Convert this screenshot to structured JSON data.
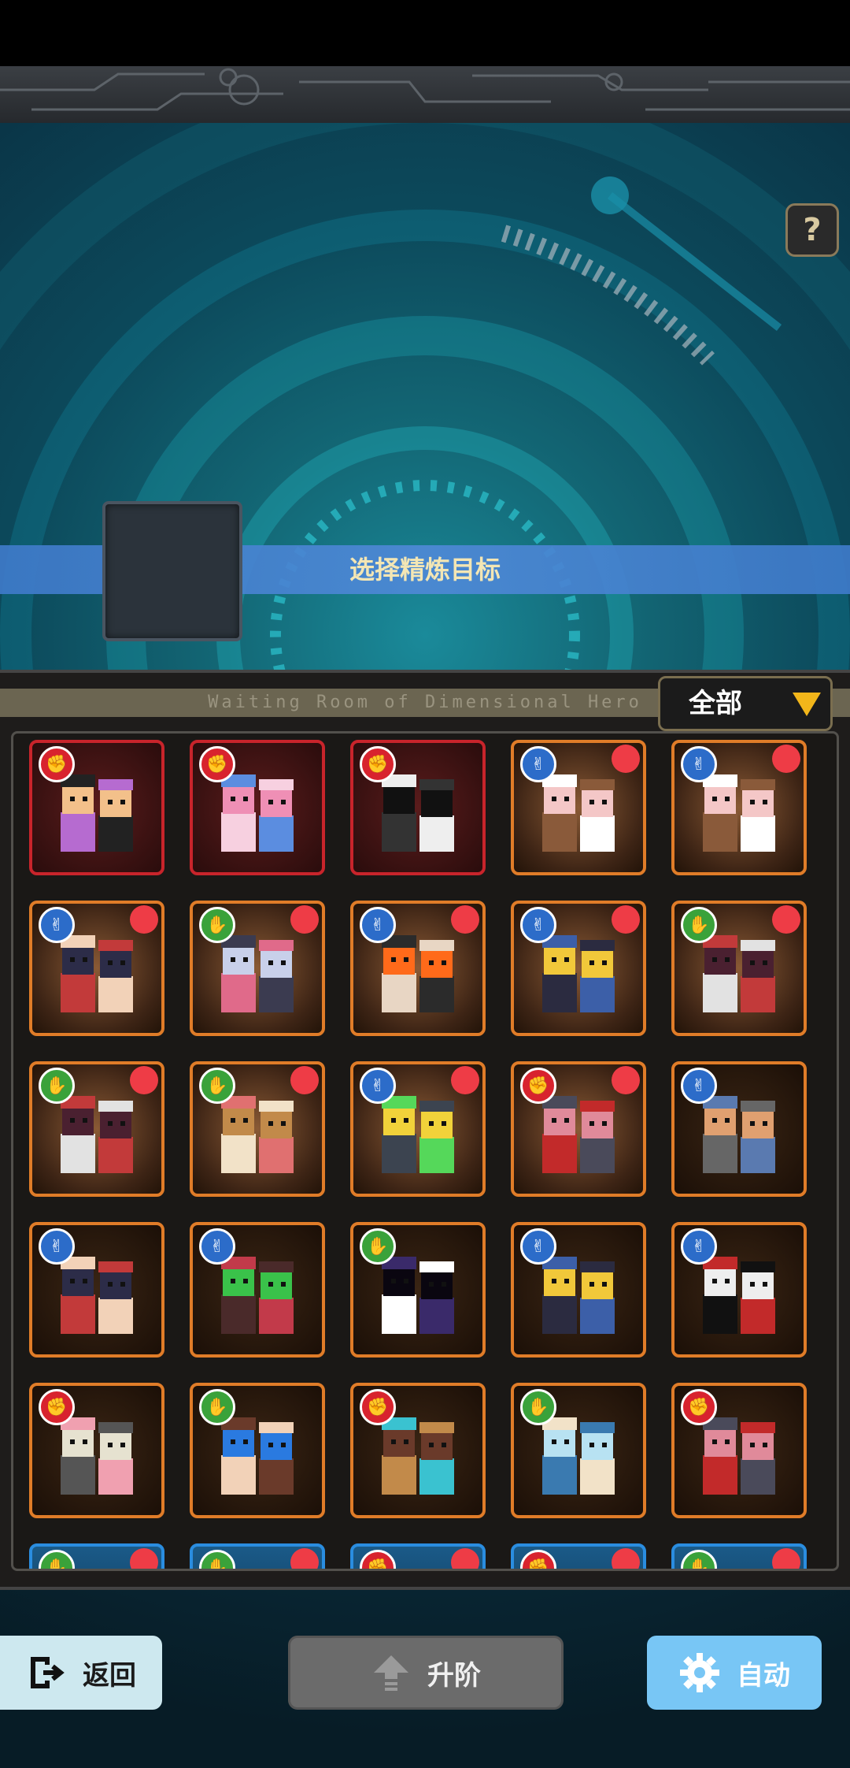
{
  "header": {
    "help_label": "?"
  },
  "banner": {
    "title": "选择精炼目标"
  },
  "strip": {
    "text": "Waiting Room of Dimensional Hero"
  },
  "filter": {
    "label": "全部"
  },
  "cards": [
    {
      "border": "red",
      "hand": "rock",
      "dot": false,
      "portrait": "crayon-boy"
    },
    {
      "border": "red",
      "hand": "rock",
      "dot": false,
      "portrait": "pink-ghost"
    },
    {
      "border": "red",
      "hand": "rock",
      "dot": false,
      "portrait": "shadow-mask"
    },
    {
      "border": "orange",
      "hand": "scissors",
      "dot": true,
      "portrait": "twins-panda"
    },
    {
      "border": "orange",
      "hand": "scissors",
      "dot": true,
      "portrait": "twins-panda"
    },
    {
      "border": "orange",
      "hand": "scissors",
      "dot": true,
      "portrait": "princess-pair"
    },
    {
      "border": "orange",
      "hand": "paper",
      "dot": true,
      "portrait": "silver-hair-ninja"
    },
    {
      "border": "orange",
      "hand": "scissors",
      "dot": true,
      "portrait": "orange-hair-kid"
    },
    {
      "border": "orange",
      "hand": "scissors",
      "dot": true,
      "portrait": "blonde-mech"
    },
    {
      "border": "orange",
      "hand": "paper",
      "dot": true,
      "portrait": "witch-pair"
    },
    {
      "border": "orange",
      "hand": "paper",
      "dot": true,
      "portrait": "witch-pair"
    },
    {
      "border": "orange",
      "hand": "paper",
      "dot": true,
      "portrait": "hotpot-boy"
    },
    {
      "border": "orange",
      "hand": "scissors",
      "dot": true,
      "portrait": "blonde-pod"
    },
    {
      "border": "orange",
      "hand": "rock",
      "dot": true,
      "portrait": "bunny-duo"
    },
    {
      "border": "orange dark",
      "hand": "scissors",
      "dot": false,
      "portrait": "old-man-cat"
    },
    {
      "border": "orange dark",
      "hand": "scissors",
      "dot": false,
      "portrait": "princess-pair"
    },
    {
      "border": "orange dark",
      "hand": "scissors",
      "dot": false,
      "portrait": "green-hair-duo"
    },
    {
      "border": "orange dark",
      "hand": "paper",
      "dot": false,
      "portrait": "dark-spirit"
    },
    {
      "border": "orange dark",
      "hand": "scissors",
      "dot": false,
      "portrait": "blonde-mech"
    },
    {
      "border": "orange dark",
      "hand": "scissors",
      "dot": false,
      "portrait": "red-scarf-ninja"
    },
    {
      "border": "orange dark",
      "hand": "rock",
      "dot": false,
      "portrait": "mask-girls"
    },
    {
      "border": "orange dark",
      "hand": "paper",
      "dot": false,
      "portrait": "blue-slime-girl"
    },
    {
      "border": "orange dark",
      "hand": "rock",
      "dot": false,
      "portrait": "bear-fisher"
    },
    {
      "border": "orange dark",
      "hand": "paper",
      "dot": false,
      "portrait": "ice-twins"
    },
    {
      "border": "orange dark",
      "hand": "rock",
      "dot": false,
      "portrait": "bunny-duo"
    },
    {
      "border": "blue",
      "hand": "paper",
      "dot": true,
      "portrait": "partial"
    },
    {
      "border": "blue",
      "hand": "paper",
      "dot": true,
      "portrait": "partial"
    },
    {
      "border": "blue",
      "hand": "rock",
      "dot": true,
      "portrait": "partial"
    },
    {
      "border": "blue",
      "hand": "rock",
      "dot": true,
      "portrait": "partial"
    },
    {
      "border": "blue",
      "hand": "paper",
      "dot": true,
      "portrait": "partial"
    }
  ],
  "buttons": {
    "back": "返回",
    "upgrade": "升阶",
    "auto": "自动"
  },
  "colors": {
    "banner": "#4e89d6",
    "rock": "#d8232e",
    "paper": "#3aa23a",
    "scissors": "#2c6cc9",
    "card_orange": "#e07c28",
    "card_red": "#c8242b",
    "auto_button": "#78c6f5"
  }
}
